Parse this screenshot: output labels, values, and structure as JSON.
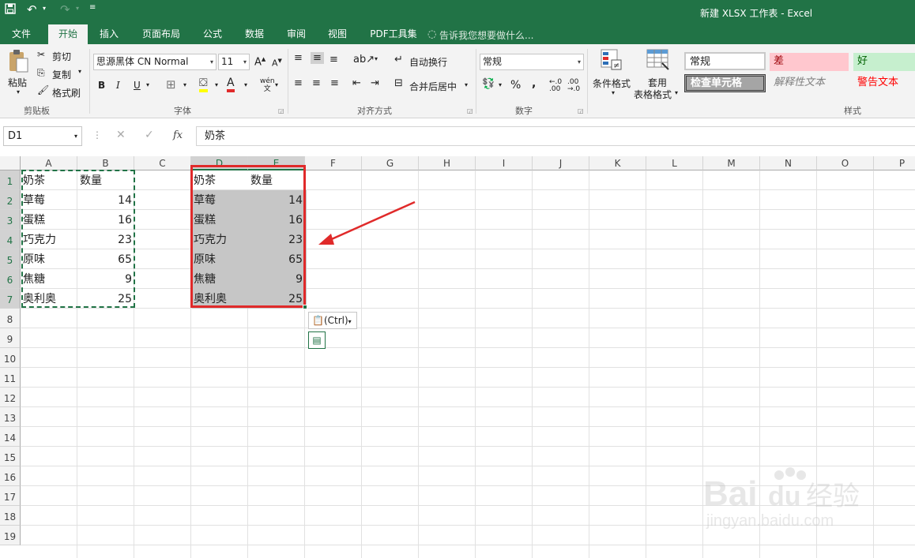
{
  "app": {
    "title": "新建 XLSX 工作表 - Excel"
  },
  "tabs": [
    "文件",
    "开始",
    "插入",
    "页面布局",
    "公式",
    "数据",
    "审阅",
    "视图",
    "PDF工具集"
  ],
  "tell_me": "告诉我您想要做什么...",
  "clipboard": {
    "paste": "粘贴",
    "cut": "剪切",
    "copy": "复制",
    "format_painter": "格式刷",
    "group": "剪贴板"
  },
  "font": {
    "name": "思源黑体 CN Normal",
    "size": "11",
    "group": "字体",
    "bold": "B",
    "italic": "I",
    "underline": "U",
    "wen": "wén",
    "wen_char": "文"
  },
  "align": {
    "wrap": "自动换行",
    "merge": "合并后居中",
    "group": "对齐方式"
  },
  "number": {
    "format": "常规",
    "group": "数字",
    "percent": "%",
    "comma": ",",
    "inc_dec": "←.0\n.00",
    "dec_dec": ".00\n→.0"
  },
  "styles": {
    "conditional": "条件格式",
    "table_format_1": "套用",
    "table_format_2": "表格格式",
    "group": "样式",
    "normal": "常规",
    "bad": "差",
    "good": "好",
    "check": "检查单元格",
    "explanatory": "解释性文本",
    "warning": "警告文本"
  },
  "formula_bar": {
    "name_box": "D1",
    "fx": "fx",
    "content": "奶茶"
  },
  "columns": [
    "A",
    "B",
    "C",
    "D",
    "E",
    "F",
    "G",
    "H",
    "I",
    "J",
    "K",
    "L",
    "M",
    "N",
    "O",
    "P"
  ],
  "rows": [
    "1",
    "2",
    "3",
    "4",
    "5",
    "6",
    "7",
    "8",
    "9",
    "10",
    "11",
    "12",
    "13",
    "14",
    "15",
    "16",
    "17",
    "18",
    "19"
  ],
  "table_ab": [
    [
      "奶茶",
      "数量"
    ],
    [
      "草莓",
      "14"
    ],
    [
      "蛋糕",
      "16"
    ],
    [
      "巧克力",
      "23"
    ],
    [
      "原味",
      "65"
    ],
    [
      "焦糖",
      "9"
    ],
    [
      "奥利奥",
      "25"
    ]
  ],
  "table_de": [
    [
      "奶茶",
      "数量"
    ],
    [
      "草莓",
      "14"
    ],
    [
      "蛋糕",
      "16"
    ],
    [
      "巧克力",
      "23"
    ],
    [
      "原味",
      "65"
    ],
    [
      "焦糖",
      "9"
    ],
    [
      "奥利奥",
      "25"
    ]
  ],
  "paste_options": {
    "label": "(Ctrl)"
  },
  "colors": {
    "excel_green": "#217346",
    "highlight_red": "#e02a2a",
    "selection_gray": "#c6c6c6",
    "copy_marquee": "#217346"
  },
  "watermark": {
    "brand": "Baidu经验",
    "url": "jingyan.baidu.com"
  }
}
